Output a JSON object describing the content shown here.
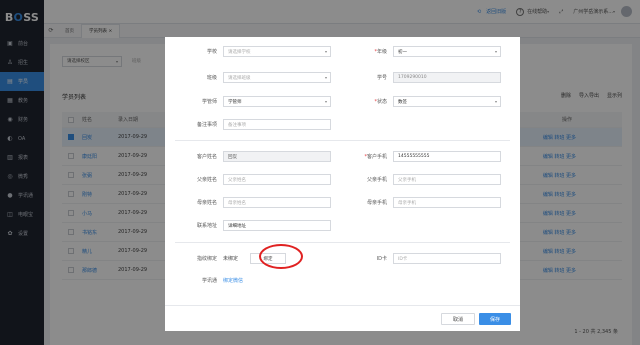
{
  "brand": {
    "part1": "B",
    "part2": "O",
    "part3": "SS"
  },
  "sidebar": {
    "items": [
      {
        "label": "前台",
        "icon": "desk-icon"
      },
      {
        "label": "招生",
        "icon": "user-plus-icon"
      },
      {
        "label": "学员",
        "icon": "student-icon",
        "active": true
      },
      {
        "label": "教务",
        "icon": "book-icon"
      },
      {
        "label": "财务",
        "icon": "money-icon"
      },
      {
        "label": "OA",
        "icon": "oa-icon"
      },
      {
        "label": "报表",
        "icon": "report-icon"
      },
      {
        "label": "微秀",
        "icon": "wechat-icon"
      },
      {
        "label": "学讯通",
        "icon": "message-icon"
      },
      {
        "label": "电眼宝",
        "icon": "camera-icon"
      },
      {
        "label": "设置",
        "icon": "gear-icon"
      }
    ]
  },
  "topbar": {
    "back_label": "返回旧版",
    "help_label": "在线帮助",
    "org_label": "广州学岳演示系..."
  },
  "tabs": [
    {
      "label": "首页"
    },
    {
      "label": "学员列表",
      "close": "×"
    }
  ],
  "filter": {
    "campus_placeholder": "请选择校区",
    "other": "班级"
  },
  "list": {
    "title": "学员列表",
    "actions": [
      "删除",
      "导入导出",
      "显示列"
    ],
    "headers": {
      "name": "姓名",
      "date": "录入日期",
      "ops": "操作"
    },
    "rows": [
      {
        "name": "回炭",
        "date": "2017-09-29",
        "ops": "编辑 转班 更多"
      },
      {
        "name": "康廷阳",
        "date": "2017-09-29",
        "ops": "编辑 转班 更多"
      },
      {
        "name": "张弼",
        "date": "2017-09-29",
        "ops": "编辑 转班 更多"
      },
      {
        "name": "刚特",
        "date": "2017-09-29",
        "ops": "编辑 转班 更多"
      },
      {
        "name": "小马",
        "date": "2017-09-29",
        "ops": "编辑 转班 更多"
      },
      {
        "name": "书铭东",
        "date": "2017-09-29",
        "ops": "编辑 转班 更多"
      },
      {
        "name": "精儿",
        "date": "2017-09-29",
        "ops": "编辑 转班 更多"
      },
      {
        "name": "那郎德",
        "date": "2017-09-29",
        "ops": "编辑 转班 更多"
      }
    ],
    "ops_header2": "学员备注",
    "pager": "1 - 20  共 2,345 条"
  },
  "modal": {
    "school": {
      "label": "学校",
      "placeholder": "请选择学校"
    },
    "grade": {
      "label": "年级",
      "value": "初一"
    },
    "class": {
      "label": "班级",
      "placeholder": "请选择班级"
    },
    "student_no": {
      "label": "学号",
      "value": "1709290010"
    },
    "manager": {
      "label": "学管师",
      "placeholder": "学管师"
    },
    "status": {
      "label": "状态",
      "value": "数签"
    },
    "remark": {
      "label": "备注事项",
      "placeholder": "备注事项"
    },
    "customer_name": {
      "label": "客户姓名",
      "value": "回炭"
    },
    "customer_phone": {
      "label": "客户手机",
      "value": "14555555555"
    },
    "father_name": {
      "label": "父亲姓名",
      "placeholder": "父亲姓名"
    },
    "father_phone": {
      "label": "父亲手机",
      "placeholder": "父亲手机"
    },
    "mother_name": {
      "label": "母亲姓名",
      "placeholder": "母亲姓名"
    },
    "mother_phone": {
      "label": "母亲手机",
      "placeholder": "母亲手机"
    },
    "address": {
      "label": "联系地址",
      "placeholder": "详细地址"
    },
    "attendance": {
      "label": "指纹绑定",
      "status": "未绑定",
      "button": "绑定"
    },
    "id_card": {
      "label": "ID卡",
      "placeholder": "ID卡"
    },
    "xuexuntong": {
      "label": "学讯通",
      "link": "绑定微信"
    },
    "cancel": "取消",
    "save": "保存"
  }
}
